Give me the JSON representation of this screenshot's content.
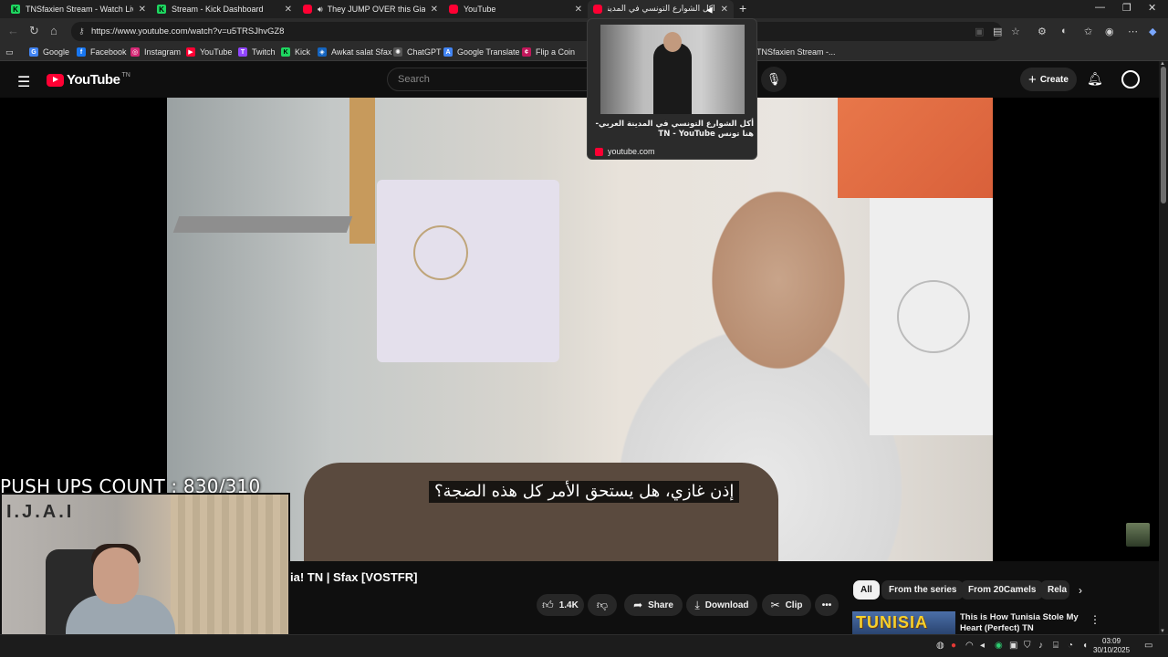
{
  "browser": {
    "tabs": [
      {
        "title": "TNSfaxien Stream - Watch Live on",
        "favicon": "kick-icon",
        "active": false
      },
      {
        "title": "Stream - Kick Dashboard",
        "favicon": "kick-icon",
        "active": false
      },
      {
        "title": "They JUMP OVER this Giant T",
        "favicon": "youtube-icon",
        "active": false,
        "audio": true
      },
      {
        "title": "YouTube",
        "favicon": "youtube-icon",
        "active": false
      },
      {
        "title": "أكل الشوارع التونسي في المدينة ال",
        "favicon": "youtube-icon",
        "active": true
      }
    ],
    "url": "https://www.youtube.com/watch?v=u5TRSJhvGZ8",
    "bookmarks": [
      {
        "label": "Google",
        "color": "#4285f4"
      },
      {
        "label": "Facebook",
        "color": "#1877f2"
      },
      {
        "label": "Instagram",
        "color": "#d62976"
      },
      {
        "label": "YouTube",
        "color": "#ff0033"
      },
      {
        "label": "Twitch",
        "color": "#9146ff"
      },
      {
        "label": "Kick",
        "color": "#1ed760"
      },
      {
        "label": "Awkat salat Sfax",
        "color": "#1565c0"
      },
      {
        "label": "ChatGPT",
        "color": "#555555"
      },
      {
        "label": "Google Translate",
        "color": "#4285f4"
      },
      {
        "label": "Flip a Coin",
        "color": "#c2185b"
      },
      {
        "label": "TNSfaxien Stream -...",
        "color": "#1ed760"
      }
    ]
  },
  "preview": {
    "title": "أكل الشوارع التونسي في المدينة العربي-هنا تونس TN - YouTube",
    "domain": "youtube.com"
  },
  "youtube": {
    "logo_text": "YouTube",
    "country_code": "TN",
    "search_placeholder": "Search",
    "create_label": "Create"
  },
  "video": {
    "subtitle": "إذن غازي، هل يستحق الأمر كل هذه الضجة؟",
    "title": "ia! TN | Sfax [VOSTFR]",
    "likes": "1.4K",
    "share_label": "Share",
    "download_label": "Download",
    "clip_label": "Clip"
  },
  "overlay": {
    "pushups_text": "PUSH UPS COUNT : 830/310"
  },
  "sidebar": {
    "chips": [
      "All",
      "From the series",
      "From 20Camels",
      "Rela"
    ],
    "recommendation": {
      "thumb_text": "TUNISIA",
      "title": "This is How Tunisia Stole My Heart (Perfect) TN"
    }
  },
  "taskbar": {
    "time": "03:09",
    "date": "30/10/2025"
  }
}
